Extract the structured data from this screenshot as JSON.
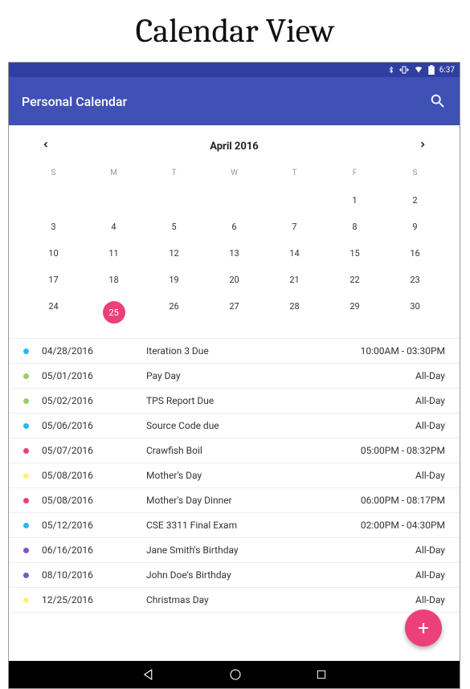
{
  "page_heading": "Calendar View",
  "status_bar": {
    "time": "6:37"
  },
  "app_bar": {
    "title": "Personal Calendar"
  },
  "month_nav": {
    "label": "April 2016"
  },
  "day_headers": [
    "S",
    "M",
    "T",
    "W",
    "T",
    "F",
    "S"
  ],
  "calendar": {
    "leading_blanks": 5,
    "days": 30,
    "today": 25
  },
  "events": [
    {
      "color": "#29b6f6",
      "date": "04/28/2016",
      "title": "Iteration 3 Due",
      "time": "10:00AM - 03:30PM"
    },
    {
      "color": "#9ccc65",
      "date": "05/01/2016",
      "title": "Pay Day",
      "time": "All-Day"
    },
    {
      "color": "#9ccc65",
      "date": "05/02/2016",
      "title": "TPS Report Due",
      "time": "All-Day"
    },
    {
      "color": "#29b6f6",
      "date": "05/06/2016",
      "title": "Source Code due",
      "time": "All-Day"
    },
    {
      "color": "#ec407a",
      "date": "05/07/2016",
      "title": "Crawfish Boil",
      "time": "05:00PM - 08:32PM"
    },
    {
      "color": "#fff176",
      "date": "05/08/2016",
      "title": "Mother's Day",
      "time": "All-Day"
    },
    {
      "color": "#ec407a",
      "date": "05/08/2016",
      "title": "Mother's Day Dinner",
      "time": "06:00PM - 08:17PM"
    },
    {
      "color": "#29b6f6",
      "date": "05/12/2016",
      "title": "CSE 3311 Final Exam",
      "time": "02:00PM - 04:30PM"
    },
    {
      "color": "#7e57c2",
      "date": "06/16/2016",
      "title": "Jane Smith's Birthday",
      "time": "All-Day"
    },
    {
      "color": "#7e57c2",
      "date": "08/10/2016",
      "title": "John Doe's Birthday",
      "time": "All-Day"
    },
    {
      "color": "#fff176",
      "date": "12/25/2016",
      "title": "Christmas Day",
      "time": "All-Day"
    }
  ],
  "colors": {
    "primary": "#3f51b5",
    "primary_dark": "#303f9f",
    "accent": "#ec407a"
  }
}
